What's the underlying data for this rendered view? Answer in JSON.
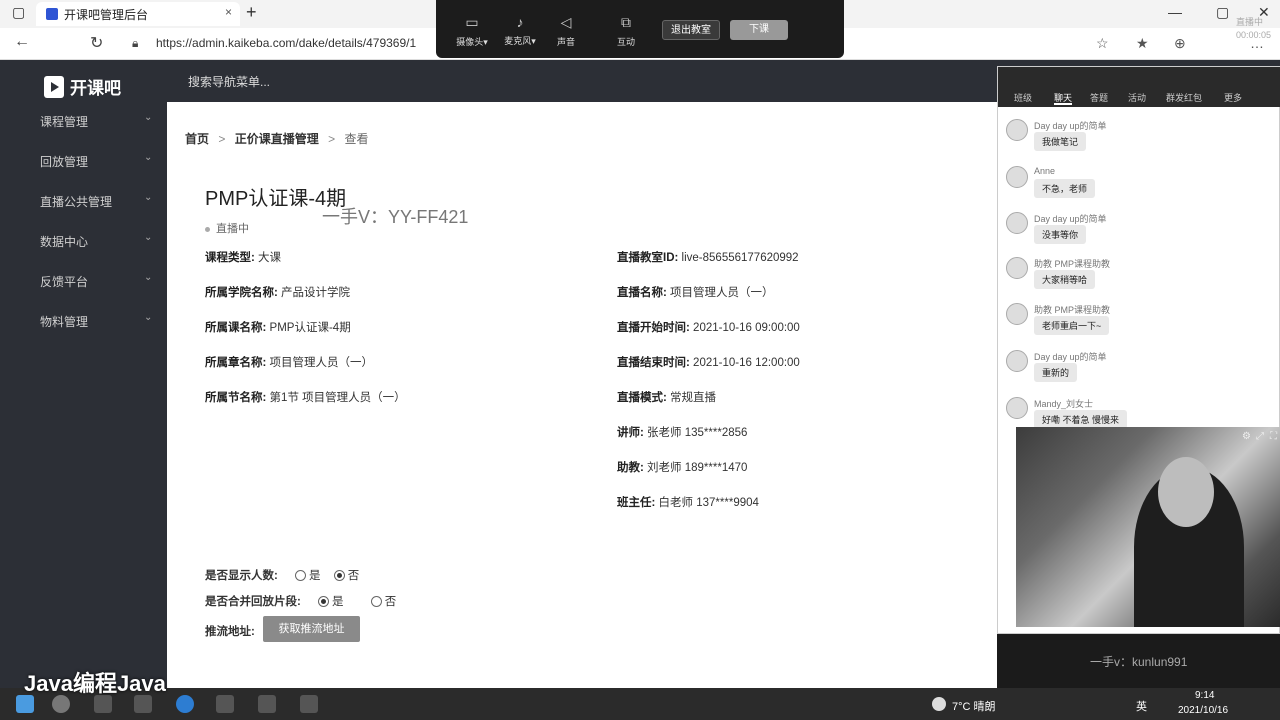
{
  "browser": {
    "tab_title": "开课吧管理后台",
    "tab_close": "×",
    "new_tab": "+",
    "url": "https://admin.kaikeba.com/dake/details/479369/1"
  },
  "live_toolbar": {
    "camera": "摄像头▾",
    "mic": "麦克风▾",
    "sound": "声音",
    "interact": "互动",
    "exit": "退出教室",
    "end": "下课",
    "status_line1": "直播中",
    "status_line2": "00:00:05"
  },
  "sidebar": {
    "brand": "开课吧",
    "items": [
      {
        "label": "课程管理"
      },
      {
        "label": "回放管理"
      },
      {
        "label": "直播公共管理"
      },
      {
        "label": "数据中心"
      },
      {
        "label": "反馈平台"
      },
      {
        "label": "物料管理"
      }
    ],
    "chevron": "⌄"
  },
  "topbar": {
    "search_placeholder": "搜索导航菜单..."
  },
  "breadcrumb": {
    "home": "首页",
    "section": "正价课直播管理",
    "current": "查看",
    "sep": ">"
  },
  "course": {
    "title": "PMP认证课-4期",
    "status": "直播中",
    "left_fields": [
      {
        "key": "课程类型:",
        "value": "大课"
      },
      {
        "key": "所属学院名称:",
        "value": "产品设计学院"
      },
      {
        "key": "所属课名称:",
        "value": "PMP认证课-4期"
      },
      {
        "key": "所属章名称:",
        "value": "项目管理人员（一）"
      },
      {
        "key": "所属节名称:",
        "value": "第1节 项目管理人员（一）"
      }
    ],
    "right_fields": [
      {
        "key": "直播教室ID:",
        "value": "live-856556177620992"
      },
      {
        "key": "直播名称:",
        "value": "项目管理人员（一）"
      },
      {
        "key": "直播开始时间:",
        "value": "2021-10-16 09:00:00"
      },
      {
        "key": "直播结束时间:",
        "value": "2021-10-16 12:00:00"
      },
      {
        "key": "直播模式:",
        "value": "常规直播"
      },
      {
        "key": "讲师:",
        "value": "张老师 135****2856"
      },
      {
        "key": "助教:",
        "value": "刘老师 189****1470"
      },
      {
        "key": "班主任:",
        "value": "白老师 137****9904"
      }
    ],
    "show_count": {
      "key": "是否显示人数:",
      "yes": "是",
      "no": "否",
      "selected": "no"
    },
    "merge_replay": {
      "key": "是否合并回放片段:",
      "yes": "是",
      "no": "否",
      "selected": "yes"
    },
    "push_url": {
      "key": "推流地址:",
      "button": "获取推流地址"
    }
  },
  "watermark": "一手V：YY-FF421",
  "watermark2": "一手v：kunlun991",
  "chat": {
    "tabs": [
      "班级",
      "聊天",
      "答题",
      "活动",
      "群发红包",
      "更多"
    ],
    "active_tab": 1,
    "messages": [
      {
        "name": "Day day up的简单",
        "text": "我做笔记"
      },
      {
        "name": "Anne",
        "text": "不急，老师"
      },
      {
        "name": "Day day up的简单",
        "text": "没事等你"
      },
      {
        "name": "助教 PMP课程助教",
        "text": "大家稍等哈"
      },
      {
        "name": "助教 PMP课程助教",
        "text": "老师重启一下~"
      },
      {
        "name": "Day day up的简单",
        "text": "重新的"
      },
      {
        "name": "Mandy_刘女士",
        "text": "好嘞 不着急 慢慢来"
      }
    ]
  },
  "taskbar": {
    "weather": "7°C 晴朗",
    "ime": "英",
    "time": "9:14",
    "date": "2021/10/16"
  },
  "overlay_text": "Java编程Java"
}
